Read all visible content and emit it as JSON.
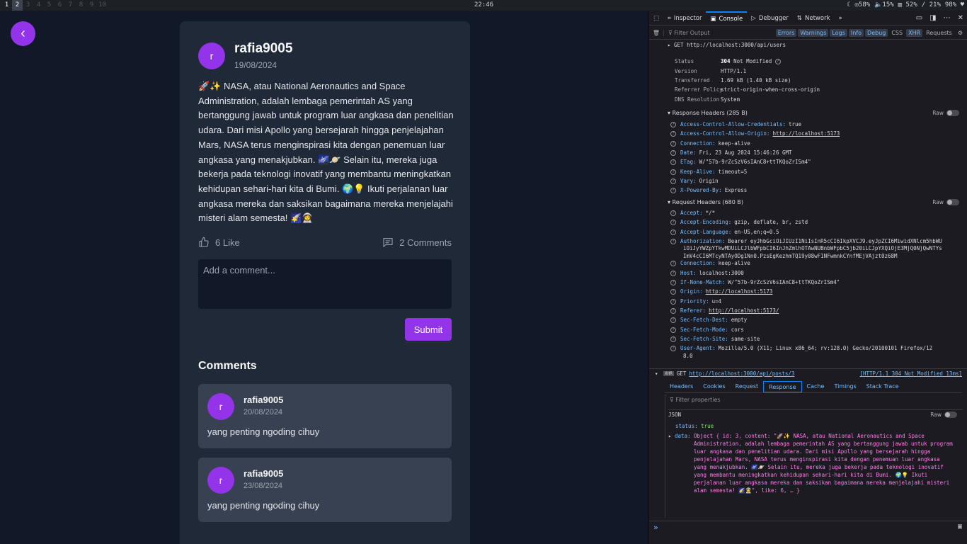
{
  "topbar": {
    "workspaces": [
      "1",
      "2",
      "3",
      "4",
      "5",
      "6",
      "7",
      "8",
      "9",
      "10"
    ],
    "clock": "22:46",
    "tray": {
      "moon": "☾",
      "cpu": "58%",
      "volume": "15%",
      "memory": "52%",
      "brightness": "21%",
      "battery": "98%"
    }
  },
  "app": {
    "back_icon": "‹",
    "post": {
      "avatar_letter": "r",
      "author": "rafia9005",
      "date": "19/08/2024",
      "content": "🚀✨ NASA, atau National Aeronautics and Space Administration, adalah lembaga pemerintah AS yang bertanggung jawab untuk program luar angkasa dan penelitian udara. Dari misi Apollo yang bersejarah hingga penjelajahan Mars, NASA terus menginspirasi kita dengan penemuan luar angkasa yang menakjubkan. 🌌🪐 Selain itu, mereka juga bekerja pada teknologi inovatif yang membantu meningkatkan kehidupan sehari-hari kita di Bumi. 🌍💡 Ikuti perjalanan luar angkasa mereka dan saksikan bagaimana mereka menjelajahi misteri alam semesta! 🌠👩‍🚀",
      "likes_label": "6 Like",
      "comments_label": "2 Comments"
    },
    "comment_form": {
      "placeholder": "Add a comment...",
      "submit_label": "Submit"
    },
    "comments_title": "Comments",
    "comments": [
      {
        "avatar_letter": "r",
        "author": "rafia9005",
        "date": "20/08/2024",
        "text": "yang penting ngoding cihuy"
      },
      {
        "avatar_letter": "r",
        "author": "rafia9005",
        "date": "23/08/2024",
        "text": "yang penting ngoding cihuy"
      }
    ]
  },
  "devtools": {
    "tabs": [
      "Inspector",
      "Console",
      "Debugger",
      "Network"
    ],
    "selected_tab": "Console",
    "filter_placeholder": "Filter Output",
    "log_filters": [
      "Errors",
      "Warnings",
      "Logs",
      "Info",
      "Debug",
      "CSS",
      "XHR",
      "Requests"
    ],
    "request_line": "GET http://localhost:3000/api/users",
    "status": {
      "status_label": "Status",
      "status_code": "304",
      "status_text": "Not Modified",
      "version_label": "Version",
      "version": "HTTP/1.1",
      "transferred_label": "Transferred",
      "transferred": "1.69 kB (1.40 kB size)",
      "referrer_label": "Referrer Policy",
      "referrer": "strict-origin-when-cross-origin",
      "dns_label": "DNS Resolution",
      "dns": "System"
    },
    "response_headers_title": "Response Headers (285 B)",
    "raw_label": "Raw",
    "response_headers": [
      {
        "name": "Access-Control-Allow-Credentials:",
        "value": "true"
      },
      {
        "name": "Access-Control-Allow-Origin:",
        "value": "http://localhost:5173"
      },
      {
        "name": "Connection:",
        "value": "keep-alive"
      },
      {
        "name": "Date:",
        "value": "Fri, 23 Aug 2024 15:46:26 GMT"
      },
      {
        "name": "ETag:",
        "value": "W/\"57b-9rZcSzV6sIAnC8+ttTKQoZrISm4\""
      },
      {
        "name": "Keep-Alive:",
        "value": "timeout=5"
      },
      {
        "name": "Vary:",
        "value": "Origin"
      },
      {
        "name": "X-Powered-By:",
        "value": "Express"
      }
    ],
    "request_headers_title": "Request Headers (680 B)",
    "request_headers": [
      {
        "name": "Accept:",
        "value": "*/*"
      },
      {
        "name": "Accept-Encoding:",
        "value": "gzip, deflate, br, zstd"
      },
      {
        "name": "Accept-Language:",
        "value": "en-US,en;q=0.5"
      },
      {
        "name": "Authorization:",
        "value": "Bearer eyJhbGciOiJIUzI1NiIsInR5cCI6IkpXVCJ9.eyJpZCI6MiwidXNlcm5hbWU"
      },
      {
        "name": "",
        "value": "iOiJyYWZpYTkwMDUiLCJlbWFpbCI6InJhZmlhOTAwNUBnbWFpbC5jb20iLCJpYXQiOjE3MjQ0NjQwNTYs"
      },
      {
        "name": "",
        "value": "ImV4cCI6MTcyNTAyODg1Nn0.PzsEgKezhmTQ19y08wF1NFwmnkCYnfMEjVAjzt0z68M"
      },
      {
        "name": "Connection:",
        "value": "keep-alive"
      },
      {
        "name": "Host:",
        "value": "localhost:3000"
      },
      {
        "name": "If-None-Match:",
        "value": "W/\"57b-9rZcSzV6sIAnC8+ttTKQoZrISm4\""
      },
      {
        "name": "Origin:",
        "value": "http://localhost:5173"
      },
      {
        "name": "Priority:",
        "value": "u=4"
      },
      {
        "name": "Referer:",
        "value": "http://localhost:5173/"
      },
      {
        "name": "Sec-Fetch-Dest:",
        "value": "empty"
      },
      {
        "name": "Sec-Fetch-Mode:",
        "value": "cors"
      },
      {
        "name": "Sec-Fetch-Site:",
        "value": "same-site"
      },
      {
        "name": "User-Agent:",
        "value": "Mozilla/5.0 (X11; Linux x86_64; rv:128.0) Gecko/20100101 Firefox/12"
      },
      {
        "name": "",
        "value": "8.0"
      }
    ],
    "xhr": {
      "badge": "XHR",
      "method": "GET",
      "url": "http://localhost:3000/api/posts/3",
      "summary": "[HTTP/1.1 304 Not Modified 13ms]"
    },
    "response_tabs": [
      "Headers",
      "Cookies",
      "Request",
      "Response",
      "Cache",
      "Timings",
      "Stack Trace"
    ],
    "selected_response_tab": "Response",
    "filter_properties": "Filter properties",
    "json_label": "JSON",
    "json_status_key": "status:",
    "json_status_val": "true",
    "json_data_key": "data:",
    "json_data_lines": [
      "Object { id: 3, content: \"🚀✨ NASA, atau National Aeronautics and Space",
      "Administration, adalah lembaga pemerintah AS yang bertanggung jawab untuk program",
      "luar angkasa dan penelitian udara. Dari misi Apollo yang bersejarah hingga",
      "penjelajahan Mars, NASA terus menginspirasi kita dengan penemuan luar angkasa",
      "yang menakjubkan. 🌌🪐 Selain itu, mereka juga bekerja pada teknologi inovatif",
      "yang membantu meningkatkan kehidupan sehari-hari kita di Bumi. 🌍💡 Ikuti",
      "perjalanan luar angkasa mereka dan saksikan bagaimana mereka menjelajahi misteri",
      "alam semesta! 🌠👩‍🚀\", like: 6, … }"
    ],
    "console_prompt": "»"
  }
}
